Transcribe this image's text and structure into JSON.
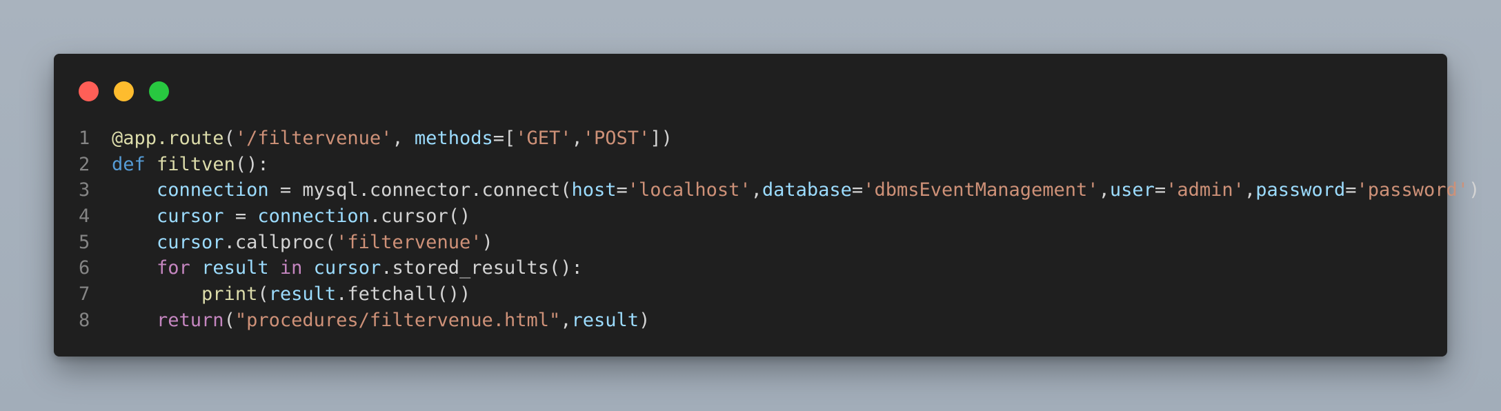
{
  "window": {
    "controls": [
      {
        "name": "close-button",
        "color": "#ff5f57"
      },
      {
        "name": "minimize-button",
        "color": "#febc2e"
      },
      {
        "name": "maximize-button",
        "color": "#28c840"
      }
    ]
  },
  "code": {
    "lines": [
      {
        "number": "1",
        "tokens": [
          {
            "text": "@app.route",
            "type": "function"
          },
          {
            "text": "(",
            "type": "plain"
          },
          {
            "text": "'/filtervenue'",
            "type": "string"
          },
          {
            "text": ", ",
            "type": "plain"
          },
          {
            "text": "methods",
            "type": "variable"
          },
          {
            "text": "=[",
            "type": "plain"
          },
          {
            "text": "'GET'",
            "type": "string"
          },
          {
            "text": ",",
            "type": "plain"
          },
          {
            "text": "'POST'",
            "type": "string"
          },
          {
            "text": "])",
            "type": "plain"
          }
        ]
      },
      {
        "number": "2",
        "tokens": [
          {
            "text": "def",
            "type": "keyword"
          },
          {
            "text": " ",
            "type": "plain"
          },
          {
            "text": "filtven",
            "type": "function"
          },
          {
            "text": "():",
            "type": "plain"
          }
        ]
      },
      {
        "number": "3",
        "tokens": [
          {
            "text": "    ",
            "type": "plain"
          },
          {
            "text": "connection",
            "type": "variable"
          },
          {
            "text": " = mysql.connector.connect(",
            "type": "plain"
          },
          {
            "text": "host",
            "type": "variable"
          },
          {
            "text": "=",
            "type": "plain"
          },
          {
            "text": "'localhost'",
            "type": "string"
          },
          {
            "text": ",",
            "type": "plain"
          },
          {
            "text": "database",
            "type": "variable"
          },
          {
            "text": "=",
            "type": "plain"
          },
          {
            "text": "'dbmsEventManagement'",
            "type": "string"
          },
          {
            "text": ",",
            "type": "plain"
          },
          {
            "text": "user",
            "type": "variable"
          },
          {
            "text": "=",
            "type": "plain"
          },
          {
            "text": "'admin'",
            "type": "string"
          },
          {
            "text": ",",
            "type": "plain"
          },
          {
            "text": "password",
            "type": "variable"
          },
          {
            "text": "=",
            "type": "plain"
          },
          {
            "text": "'password'",
            "type": "string"
          },
          {
            "text": ")",
            "type": "plain"
          }
        ]
      },
      {
        "number": "4",
        "tokens": [
          {
            "text": "    ",
            "type": "plain"
          },
          {
            "text": "cursor",
            "type": "variable"
          },
          {
            "text": " = ",
            "type": "plain"
          },
          {
            "text": "connection",
            "type": "variable"
          },
          {
            "text": ".cursor()",
            "type": "plain"
          }
        ]
      },
      {
        "number": "5",
        "tokens": [
          {
            "text": "    ",
            "type": "plain"
          },
          {
            "text": "cursor",
            "type": "variable"
          },
          {
            "text": ".callproc(",
            "type": "plain"
          },
          {
            "text": "'filtervenue'",
            "type": "string"
          },
          {
            "text": ")",
            "type": "plain"
          }
        ]
      },
      {
        "number": "6",
        "tokens": [
          {
            "text": "    ",
            "type": "plain"
          },
          {
            "text": "for",
            "type": "control"
          },
          {
            "text": " ",
            "type": "plain"
          },
          {
            "text": "result",
            "type": "variable"
          },
          {
            "text": " ",
            "type": "plain"
          },
          {
            "text": "in",
            "type": "control"
          },
          {
            "text": " ",
            "type": "plain"
          },
          {
            "text": "cursor",
            "type": "variable"
          },
          {
            "text": ".stored_results():",
            "type": "plain"
          }
        ]
      },
      {
        "number": "7",
        "tokens": [
          {
            "text": "        ",
            "type": "plain"
          },
          {
            "text": "print",
            "type": "function"
          },
          {
            "text": "(",
            "type": "plain"
          },
          {
            "text": "result",
            "type": "variable"
          },
          {
            "text": ".fetchall())",
            "type": "plain"
          }
        ]
      },
      {
        "number": "8",
        "tokens": [
          {
            "text": "    ",
            "type": "plain"
          },
          {
            "text": "return",
            "type": "control"
          },
          {
            "text": "(",
            "type": "plain"
          },
          {
            "text": "\"procedures/filtervenue.html\"",
            "type": "string"
          },
          {
            "text": ",",
            "type": "plain"
          },
          {
            "text": "result",
            "type": "variable"
          },
          {
            "text": ")",
            "type": "plain"
          }
        ]
      }
    ]
  }
}
